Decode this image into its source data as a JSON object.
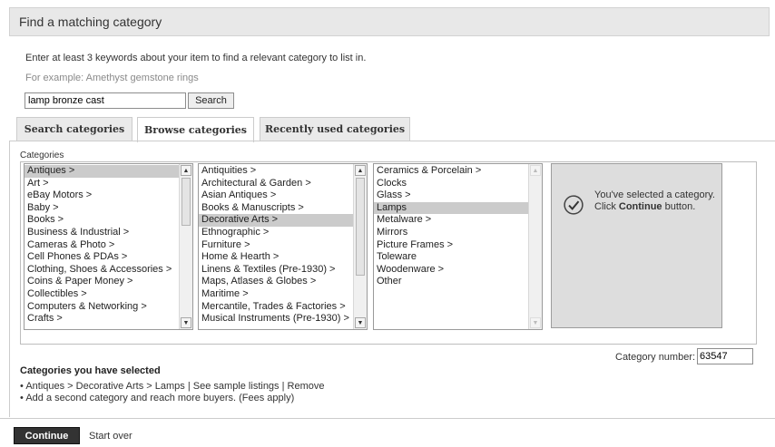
{
  "header": {
    "title": "Find a matching category"
  },
  "intro": {
    "instruction": "Enter at least 3 keywords about your item to find a relevant category to list in.",
    "example": "For example: Amethyst gemstone rings"
  },
  "search": {
    "value": "lamp bronze cast",
    "button_label": "Search"
  },
  "tabs": [
    {
      "label": "Search categories",
      "active": false
    },
    {
      "label": "Browse categories",
      "active": true
    },
    {
      "label": "Recently used categories",
      "active": false
    }
  ],
  "browser": {
    "label": "Categories",
    "col1": [
      "Antiques >",
      "Art >",
      "eBay Motors >",
      "Baby >",
      "Books >",
      "Business & Industrial >",
      "Cameras & Photo >",
      "Cell Phones & PDAs >",
      "Clothing, Shoes & Accessories >",
      "Coins & Paper Money >",
      "Collectibles >",
      "Computers & Networking >",
      "Crafts >"
    ],
    "col1_selected": 0,
    "col2": [
      "Antiquities >",
      "Architectural & Garden >",
      "Asian Antiques >",
      "Books & Manuscripts >",
      "Decorative Arts >",
      "Ethnographic >",
      "Furniture >",
      "Home & Hearth >",
      "Linens & Textiles (Pre-1930) >",
      "Maps, Atlases & Globes >",
      "Maritime >",
      "Mercantile, Trades & Factories >",
      "Musical Instruments (Pre-1930) >"
    ],
    "col2_selected": 4,
    "col3": [
      "Ceramics & Porcelain >",
      "Clocks",
      "Glass >",
      "Lamps",
      "Metalware >",
      "Mirrors",
      "Picture Frames >",
      "Toleware",
      "Woodenware >",
      "Other"
    ],
    "col3_selected": 3,
    "selected_message_pre": "You've selected a category. Click ",
    "selected_message_bold": "Continue",
    "selected_message_post": " button."
  },
  "category_number": {
    "label": "Category number:",
    "value": "63547"
  },
  "selected_categories": {
    "title": "Categories you have selected",
    "path": "Antiques > Decorative Arts > Lamps",
    "sep1": "|",
    "see_sample": "See sample listings",
    "sep2": "|",
    "remove": "Remove",
    "add_second": "Add a second category and reach more buyers. (Fees apply)"
  },
  "footer": {
    "continue_label": "Continue",
    "start_over": "Start over"
  }
}
